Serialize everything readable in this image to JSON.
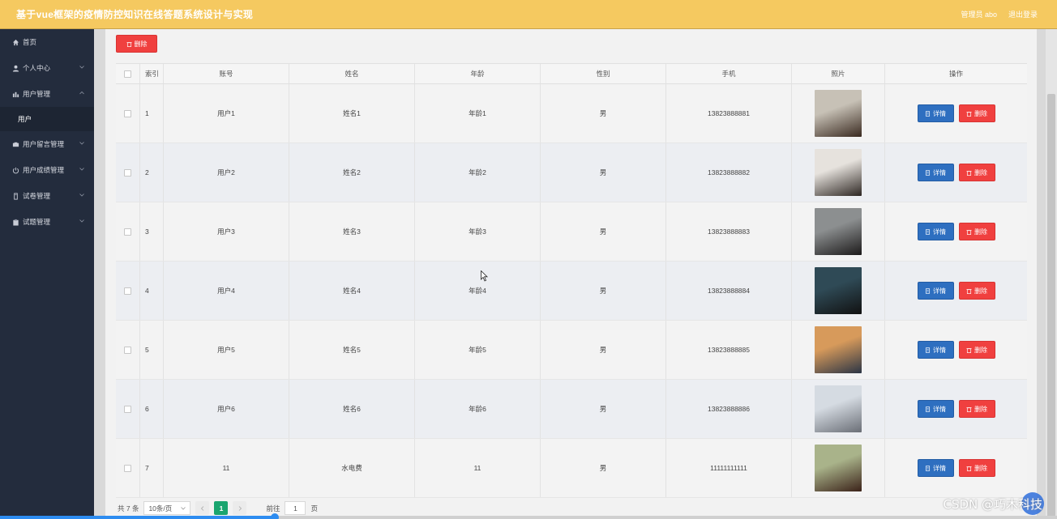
{
  "header": {
    "title": "基于vue框架的疫情防控知识在线答题系统设计与实现",
    "user": "管理员 abo",
    "logout": "退出登录"
  },
  "sidebar": {
    "items": [
      {
        "label": "首页",
        "icon": "home-icon",
        "has_arrow": false
      },
      {
        "label": "个人中心",
        "icon": "person-icon",
        "has_arrow": true
      },
      {
        "label": "用户管理",
        "icon": "chart-icon",
        "has_arrow": true,
        "expanded": true
      },
      {
        "label": "用户",
        "sub": true
      },
      {
        "label": "用户留言管理",
        "icon": "inbox-icon",
        "has_arrow": true
      },
      {
        "label": "用户成绩管理",
        "icon": "power-icon",
        "has_arrow": true
      },
      {
        "label": "试卷管理",
        "icon": "paper-icon",
        "has_arrow": true
      },
      {
        "label": "试题管理",
        "icon": "clipboard-icon",
        "has_arrow": true
      }
    ]
  },
  "toolbar": {
    "batch_delete_label": "删除"
  },
  "table": {
    "headers": [
      "索引",
      "账号",
      "姓名",
      "年龄",
      "性别",
      "手机",
      "照片",
      "操作"
    ],
    "detail_label": "详情",
    "delete_label": "删除",
    "rows": [
      {
        "index": "1",
        "account": "用户1",
        "name": "姓名1",
        "age": "年龄1",
        "sex": "男",
        "phone": "13823888881",
        "photo_colors": [
          "#c7c1b6",
          "#3a2a20"
        ]
      },
      {
        "index": "2",
        "account": "用户2",
        "name": "姓名2",
        "age": "年龄2",
        "sex": "男",
        "phone": "13823888882",
        "photo_colors": [
          "#e6e2dd",
          "#2d2622"
        ]
      },
      {
        "index": "3",
        "account": "用户3",
        "name": "姓名3",
        "age": "年龄3",
        "sex": "男",
        "phone": "13823888883",
        "photo_colors": [
          "#8c8f90",
          "#1c1a1a"
        ]
      },
      {
        "index": "4",
        "account": "用户4",
        "name": "姓名4",
        "age": "年龄4",
        "sex": "男",
        "phone": "13823888884",
        "photo_colors": [
          "#2f4a56",
          "#111111"
        ]
      },
      {
        "index": "5",
        "account": "用户5",
        "name": "姓名5",
        "age": "年龄5",
        "sex": "男",
        "phone": "13823888885",
        "photo_colors": [
          "#d79a5b",
          "#2b3545"
        ]
      },
      {
        "index": "6",
        "account": "用户6",
        "name": "姓名6",
        "age": "年龄6",
        "sex": "男",
        "phone": "13823888886",
        "photo_colors": [
          "#d5dbe2",
          "#6a6e76"
        ]
      },
      {
        "index": "7",
        "account": "11",
        "name": "水电费",
        "age": "11",
        "sex": "男",
        "phone": "11111111111",
        "photo_colors": [
          "#a9b38a",
          "#3b2219"
        ]
      }
    ]
  },
  "pagination": {
    "total_text": "共 7 条",
    "page_size": "10条/页",
    "current_page": "1",
    "goto_prefix": "前往",
    "goto_value": "1",
    "goto_suffix": "页"
  },
  "video_progress": 0.26,
  "watermark": "CSDN @巧木科技",
  "colors": {
    "header": "#f5c960",
    "sidebar": "#232c3d",
    "danger": "#f0403f",
    "primary": "#2e6fc0",
    "page_active": "#1aa56f"
  }
}
